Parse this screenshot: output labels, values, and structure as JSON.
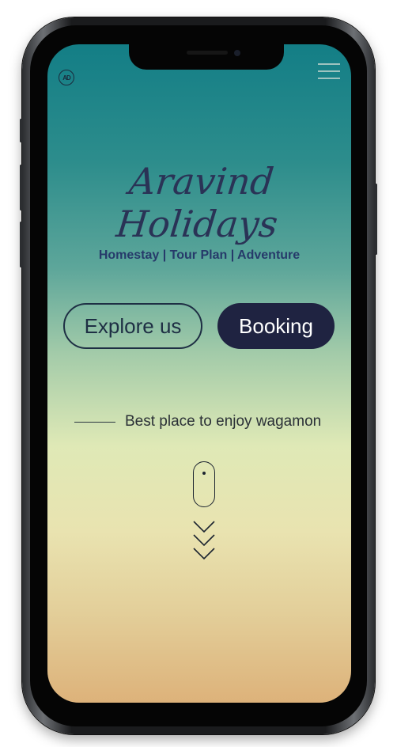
{
  "brand": {
    "logo_text": "AD",
    "title": "Aravind Holidays",
    "subtitle": "Homestay | Tour Plan | Adventure"
  },
  "nav": {
    "menu_icon": "hamburger-menu-icon"
  },
  "buttons": {
    "explore_label": "Explore us",
    "booking_label": "Booking"
  },
  "tagline": "Best place to enjoy wagamon",
  "scroll_hint": {
    "icons": [
      "mouse-icon",
      "chevron-down-icon"
    ]
  },
  "colors": {
    "gradient_top": "#137e86",
    "gradient_middle": "#dfe9b6",
    "gradient_bottom": "#ddb27a",
    "title_color": "#2a3356",
    "booking_button": "#1f2341"
  }
}
